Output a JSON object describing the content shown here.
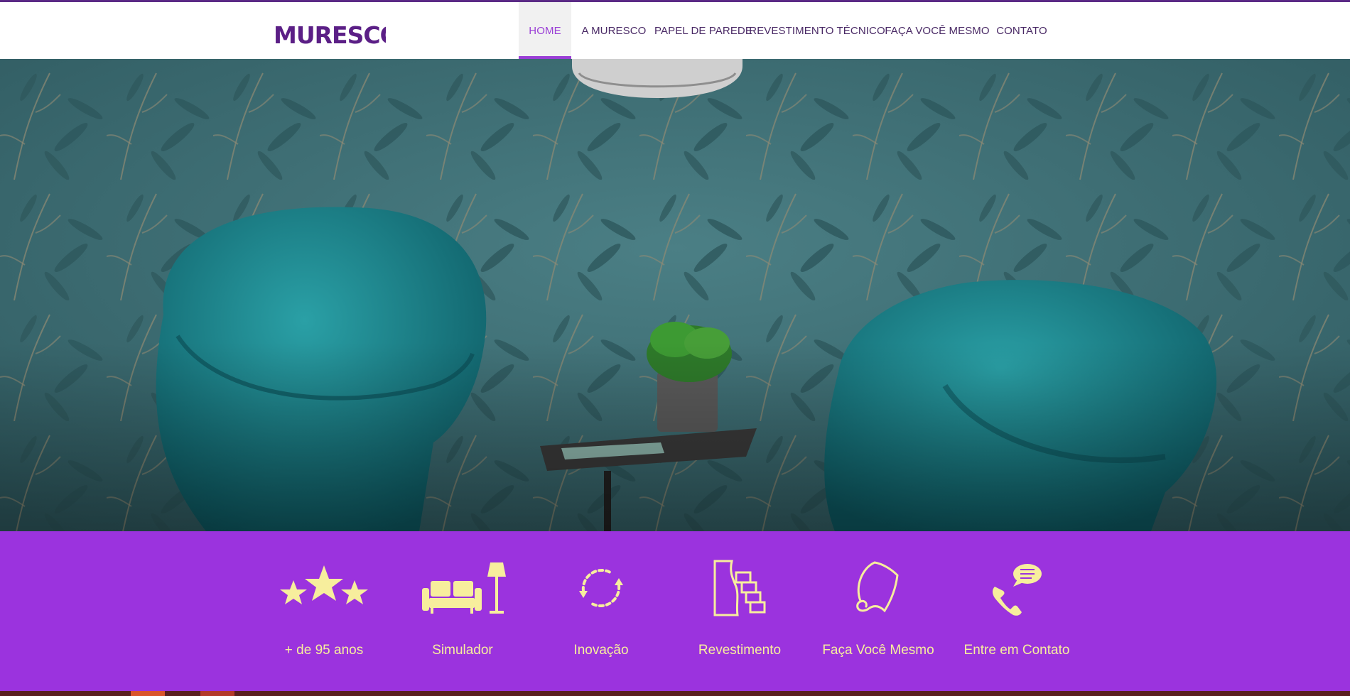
{
  "brand": {
    "logo_text": "MURESCO",
    "color": "#5b1f86"
  },
  "nav": {
    "items": [
      {
        "label": "HOME",
        "active": true
      },
      {
        "label": "A MURESCO",
        "active": false
      },
      {
        "label": "PAPEL DE PAREDE",
        "active": false
      },
      {
        "label": "REVESTIMENTO TÉCNICO",
        "active": false
      },
      {
        "label": "FAÇA VOCÊ MESMO",
        "active": false
      },
      {
        "label": "CONTATO",
        "active": false
      }
    ]
  },
  "features": [
    {
      "label": "+ de 95 anos",
      "icon": "stars-icon"
    },
    {
      "label": "Simulador",
      "icon": "sofa-lamp-icon"
    },
    {
      "label": "Inovação",
      "icon": "refresh-cycle-icon"
    },
    {
      "label": "Revestimento",
      "icon": "wall-bricks-icon"
    },
    {
      "label": "Faça Você Mesmo",
      "icon": "wallpaper-roll-icon"
    },
    {
      "label": "Entre em Contato",
      "icon": "phone-chat-icon"
    }
  ],
  "colors": {
    "accent": "#9a3fd6",
    "band": "#9b33de",
    "icon": "#f7ee9d",
    "hero_wall": "#3d6d72"
  }
}
